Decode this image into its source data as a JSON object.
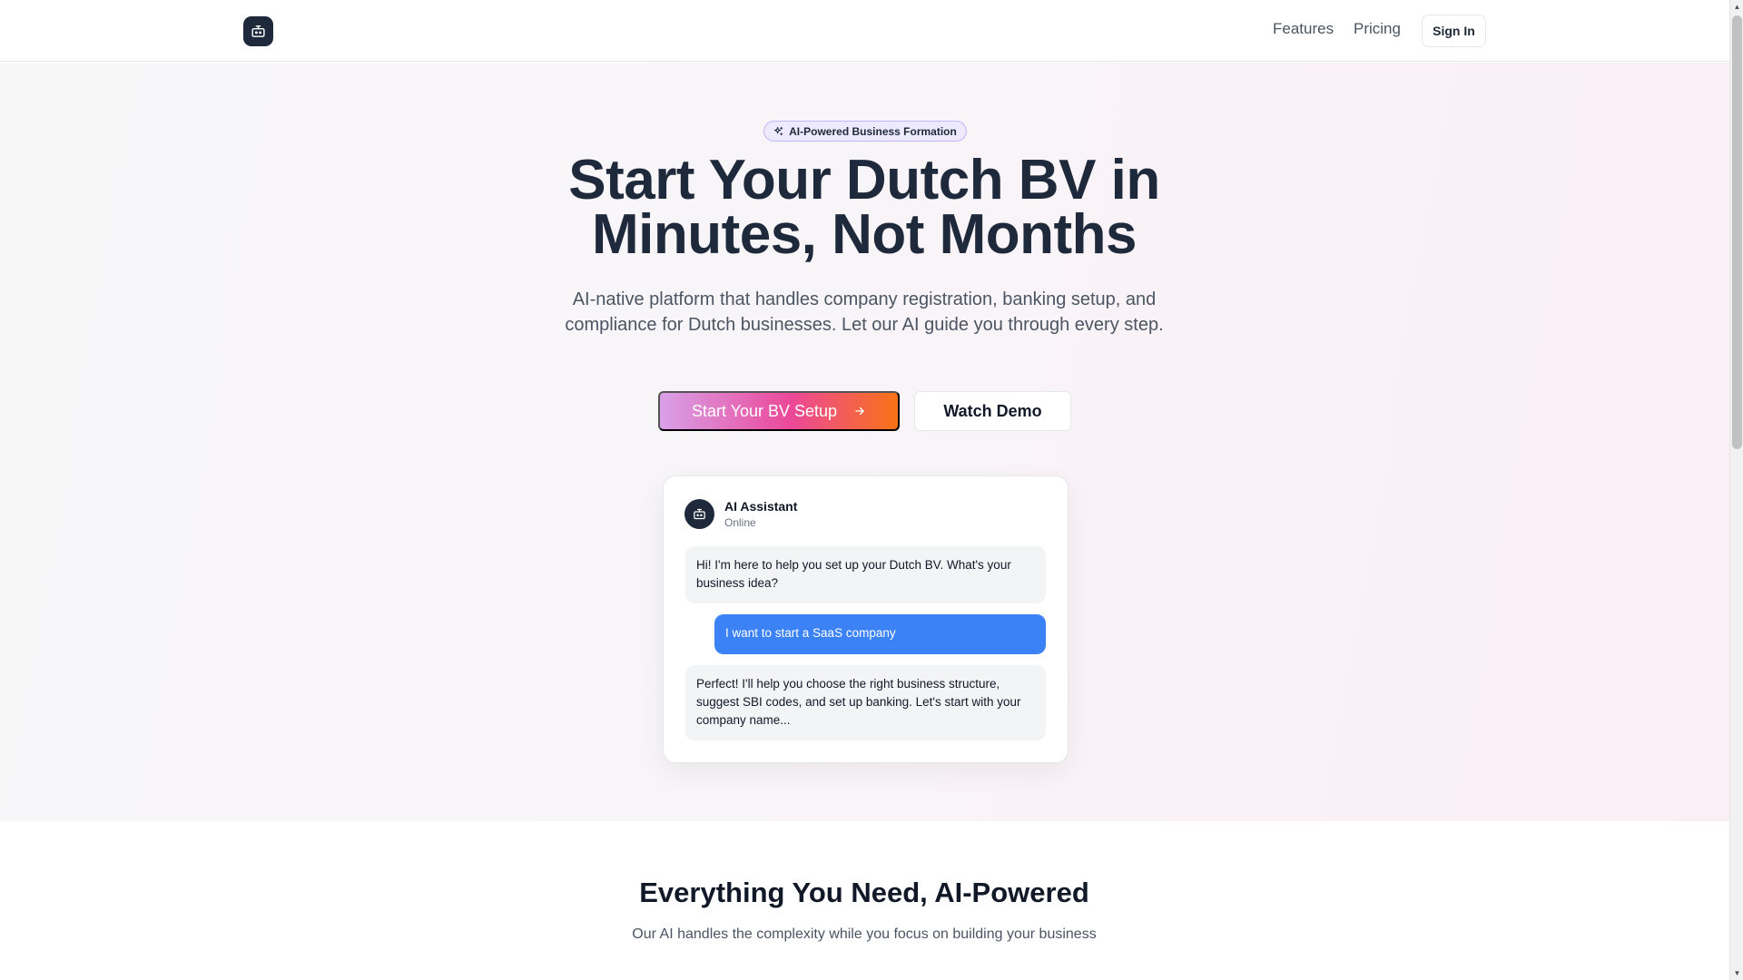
{
  "nav": {
    "logo_icon": "robot-icon",
    "features_label": "Features",
    "pricing_label": "Pricing",
    "sign_in_label": "Sign In"
  },
  "hero": {
    "badge_icon": "sparkles-icon",
    "badge_label": "AI-Powered Business Formation",
    "title_line1": "Start Your Dutch BV in",
    "title_line2": "Minutes, Not Months",
    "subtitle": "AI-native platform that handles company registration, banking setup, and compliance for Dutch businesses. Let our AI guide you through every step.",
    "primary_button": "Start Your BV Setup",
    "primary_button_icon": "arrow-right-icon",
    "secondary_button": "Watch Demo"
  },
  "chat": {
    "avatar_icon": "robot-icon",
    "name": "AI Assistant",
    "status": "Online",
    "messages": [
      {
        "role": "assistant",
        "text": "Hi! I'm here to help you set up your Dutch BV. What's your business idea?"
      },
      {
        "role": "user",
        "text": "I want to start a SaaS company"
      },
      {
        "role": "assistant",
        "text": "Perfect! I'll help you choose the right business structure, suggest SBI codes, and set up banking. Let's start with your company name..."
      }
    ]
  },
  "features": {
    "title": "Everything You Need, AI-Powered",
    "subtitle": "Our AI handles the complexity while you focus on building your business"
  },
  "colors": {
    "brand_dark": "#1e293b",
    "user_bubble": "#3b82f6",
    "gradient_start": "#d8a1e8",
    "gradient_mid": "#ec4899",
    "gradient_end": "#f97316"
  }
}
